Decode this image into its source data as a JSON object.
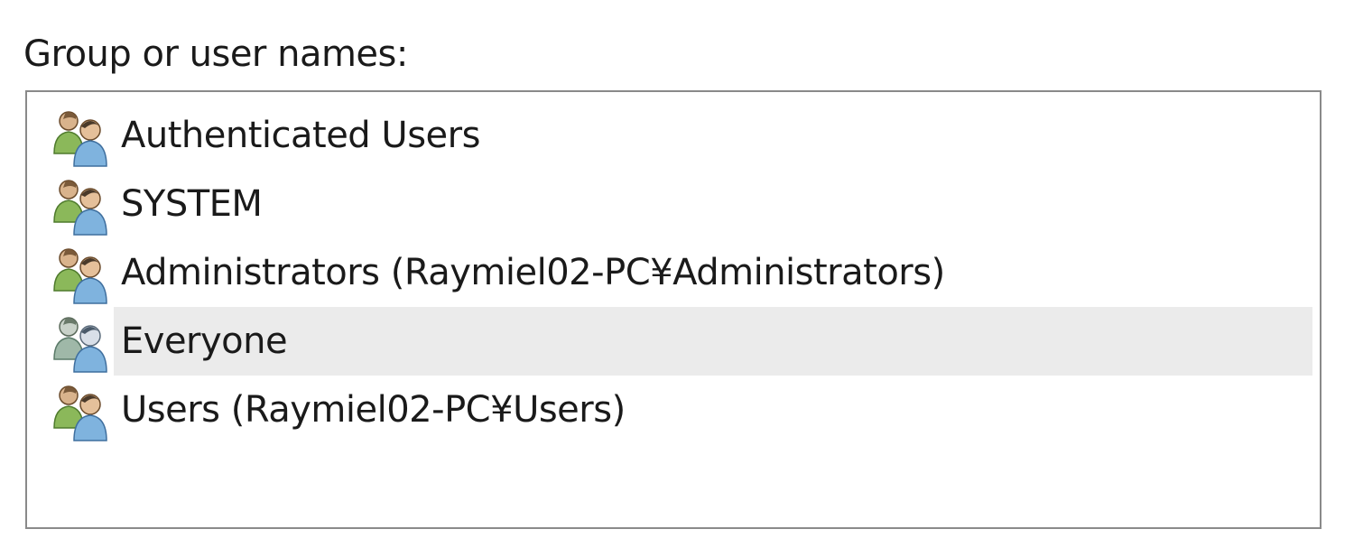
{
  "group_label": "Group or user names:",
  "principals": [
    {
      "name": "Authenticated Users",
      "icon": "user-group-icon"
    },
    {
      "name": "SYSTEM",
      "icon": "user-group-icon"
    },
    {
      "name": "Administrators (Raymiel02-PC¥Administrators)",
      "icon": "user-group-icon"
    },
    {
      "name": "Everyone",
      "icon": "user-group-icon"
    },
    {
      "name": "Users (Raymiel02-PC¥Users)",
      "icon": "user-group-icon"
    }
  ],
  "colors": {
    "list_border": "#8a8a8a",
    "hover_row": "#ebebeb",
    "back_user_green": "#8bb85a",
    "front_user_blue": "#7fb3de"
  }
}
